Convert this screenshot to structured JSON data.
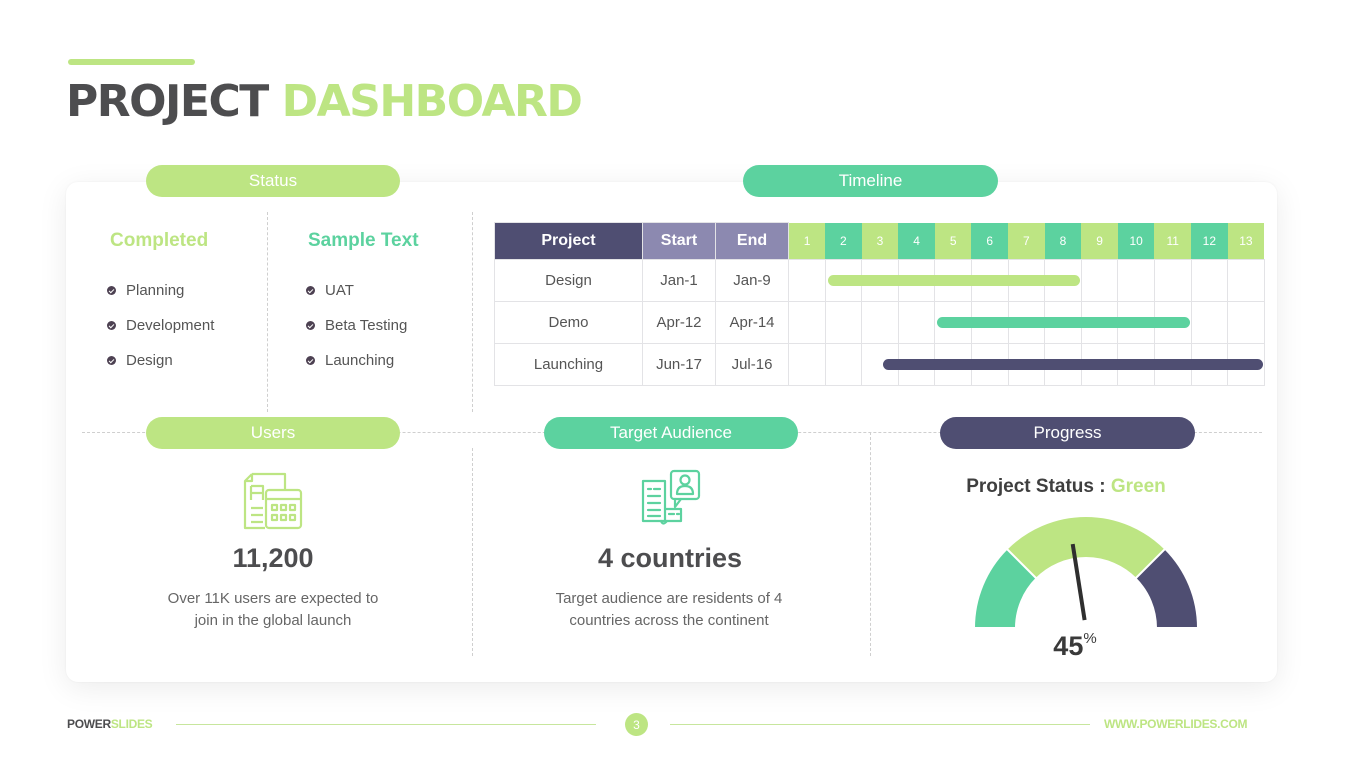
{
  "title": {
    "part1": "PROJECT",
    "part2": "DASHBOARD"
  },
  "status": {
    "label": "Status",
    "columns": [
      {
        "heading": "Completed",
        "items": [
          "Planning",
          "Development",
          "Design"
        ]
      },
      {
        "heading": "Sample Text",
        "items": [
          "UAT",
          "Beta Testing",
          "Launching"
        ]
      }
    ]
  },
  "timeline": {
    "label": "Timeline",
    "headers": {
      "project": "Project",
      "start": "Start",
      "end": "End"
    },
    "weeks": [
      "1",
      "2",
      "3",
      "4",
      "5",
      "6",
      "7",
      "8",
      "9",
      "10",
      "11",
      "12",
      "13"
    ],
    "rows": [
      {
        "project": "Design",
        "start": "Jan-1",
        "end": "Jan-9",
        "bar_from_week": 2,
        "bar_to_week": 8,
        "color": "#bde583"
      },
      {
        "project": "Demo",
        "start": "Apr-12",
        "end": "Apr-14",
        "bar_from_week": 5,
        "bar_to_week": 11,
        "color": "#5cd29f"
      },
      {
        "project": "Launching",
        "start": "Jun-17",
        "end": "Jul-16",
        "bar_from_week": 3.5,
        "bar_to_week": 13,
        "color": "#4f4e72"
      }
    ]
  },
  "users": {
    "label": "Users",
    "icon": "spreadsheet-calculator-icon",
    "value": "11,200",
    "description_line1": "Over 11K users are expected to",
    "description_line2": "join in the global launch"
  },
  "audience": {
    "label": "Target Audience",
    "icon": "book-profile-icon",
    "value": "4 countries",
    "description_line1": "Target audience are residents of 4",
    "description_line2": "countries across the continent"
  },
  "progress": {
    "label": "Progress",
    "status_label": "Project Status :",
    "status_value": "Green",
    "percent": 45,
    "percent_number": "45",
    "percent_sign": "%",
    "segments": [
      {
        "name": "low",
        "color": "#5cd29f"
      },
      {
        "name": "mid",
        "color": "#bde583"
      },
      {
        "name": "high",
        "color": "#4f4e72"
      }
    ]
  },
  "colors": {
    "green": "#bde583",
    "teal": "#5cd29f",
    "navy": "#4f4e72",
    "lavender": "#8c89b0"
  },
  "footer": {
    "brand1": "POWER",
    "brand2": "SLIDES",
    "page": "3",
    "url": "WWW.POWERLIDES.COM"
  }
}
